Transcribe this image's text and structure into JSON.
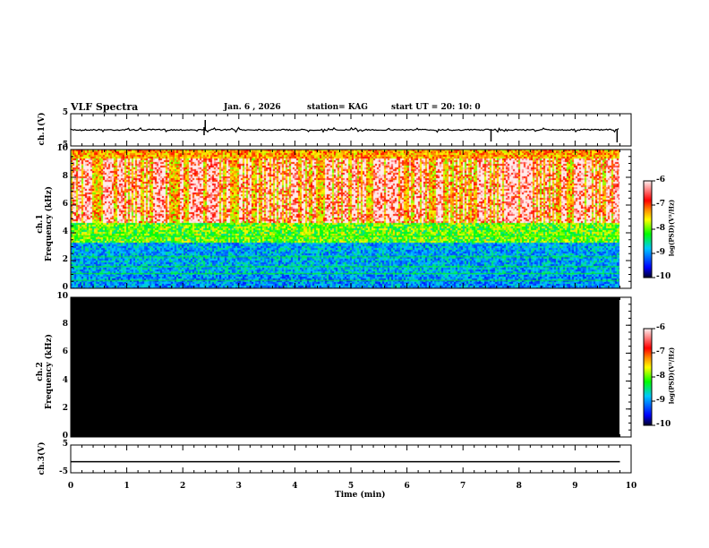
{
  "header": {
    "title": "VLF Spectra",
    "date": "Jan. 6 , 2026",
    "station": "station= KAG",
    "start": "start UT =   20: 10: 0"
  },
  "chart_data": [
    {
      "type": "line",
      "name": "ch1",
      "ylabel": "ch.1(V)",
      "ylim": [
        -5,
        5
      ],
      "yticks": [
        "5",
        "-5"
      ],
      "baseline": 0
    },
    {
      "type": "heatmap",
      "ylabel": "Frequency (kHz)",
      "channel_label": "ch.1",
      "ylim": [
        0,
        10
      ],
      "yticks": [
        "0",
        "2",
        "4",
        "6",
        "8",
        "10"
      ],
      "data_end_min": 9.8,
      "colorbar": {
        "label": "log(PSD)(V²/Hz)",
        "range": [
          -10,
          -6
        ],
        "ticks": [
          "-6",
          "-7",
          "-8",
          "-9",
          "-10"
        ]
      }
    },
    {
      "type": "heatmap",
      "ylabel": "Frequency (kHz)",
      "channel_label": "ch.2",
      "ylim": [
        0,
        10
      ],
      "yticks": [
        "0",
        "2",
        "4",
        "6",
        "8",
        "10"
      ],
      "fill": "#000000",
      "colorbar": {
        "label": "log(PSD)(V²/Hz)",
        "range": [
          -10,
          -6
        ],
        "ticks": [
          "-6",
          "-7",
          "-8",
          "-9",
          "-10"
        ]
      }
    },
    {
      "type": "line",
      "name": "ch3",
      "ylabel": "ch.3(V)",
      "ylim": [
        -5,
        5
      ],
      "yticks": [
        "5",
        "-5"
      ],
      "baseline": -1
    }
  ],
  "xaxis": {
    "label": "Time (min)",
    "range": [
      0,
      10
    ],
    "ticks": [
      "0",
      "1",
      "2",
      "3",
      "4",
      "5",
      "6",
      "7",
      "8",
      "9",
      "10"
    ]
  }
}
